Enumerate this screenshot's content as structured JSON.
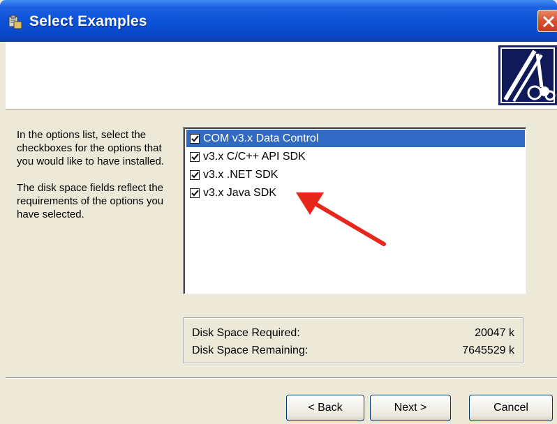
{
  "window": {
    "title": "Select Examples",
    "title_bar_color": "#0a50d6",
    "close_color": "#d7522f"
  },
  "instructions": {
    "paragraph1": "In the options list, select the checkboxes for the options that you would like to have installed.",
    "paragraph2": "The disk space fields reflect the requirements of the options you have selected."
  },
  "options": [
    {
      "label": "COM v3.x Data Control",
      "checked": true,
      "selected": true
    },
    {
      "label": "v3.x C/C++ API SDK",
      "checked": true,
      "selected": false
    },
    {
      "label": "v3.x .NET SDK",
      "checked": true,
      "selected": false
    },
    {
      "label": "v3.x Java SDK",
      "checked": true,
      "selected": false
    }
  ],
  "disk": {
    "required_label": "Disk Space Required:",
    "required_value": "20047 k",
    "remaining_label": "Disk Space Remaining:",
    "remaining_value": "7645529 k"
  },
  "buttons": {
    "back": "< Back",
    "next": "Next >",
    "cancel": "Cancel"
  },
  "annotation": {
    "arrow_color": "#e8261c"
  }
}
